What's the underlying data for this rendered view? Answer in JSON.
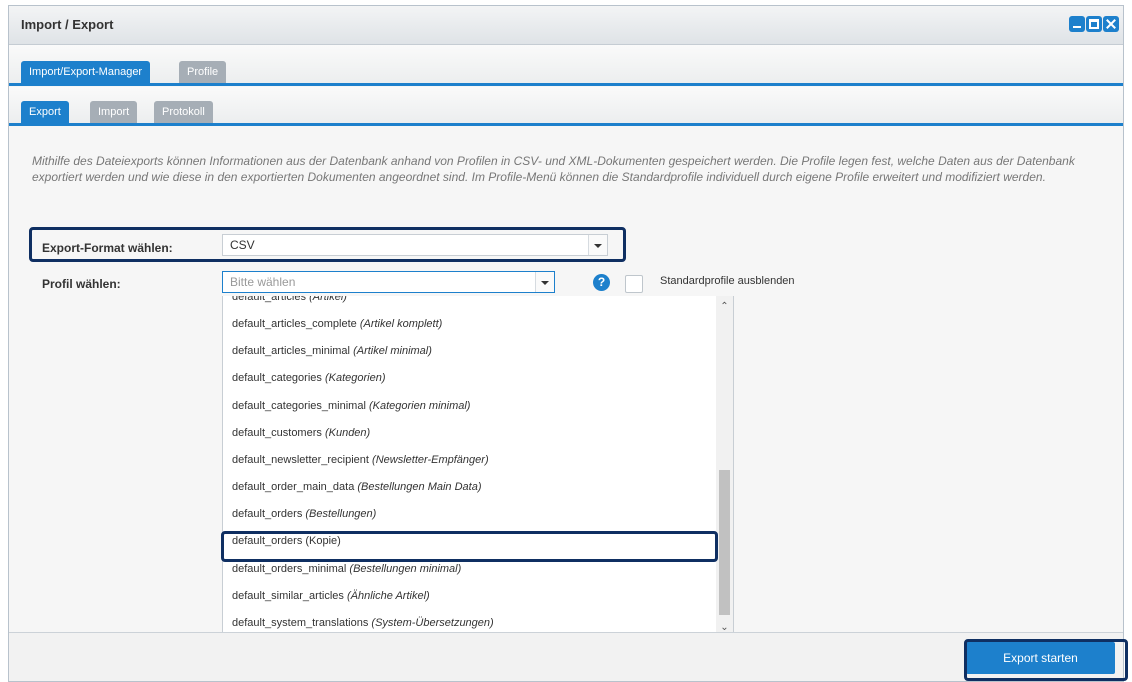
{
  "window": {
    "title": "Import / Export"
  },
  "main_tabs": [
    {
      "label": "Import/Export-Manager",
      "active": true
    },
    {
      "label": "Profile",
      "active": false
    }
  ],
  "sub_tabs": [
    {
      "label": "Export",
      "active": true
    },
    {
      "label": "Import",
      "active": false
    },
    {
      "label": "Protokoll",
      "active": false
    }
  ],
  "description": "Mithilfe des Dateiexports können Informationen aus der Datenbank anhand von Profilen in CSV- und XML-Dokumenten gespeichert werden. Die Profile legen fest, welche Daten aus der Datenbank exportiert werden und wie diese in den exportierten Dokumenten angeordnet sind. Im Profile-Menü können die Standardprofile individuell durch eigene Profile erweitert und modifiziert werden.",
  "format": {
    "label": "Export-Format wählen:",
    "value": "CSV"
  },
  "profile": {
    "label": "Profil wählen:",
    "placeholder": "Bitte wählen",
    "help": "?",
    "hide_default_label": "Standardprofile ausblenden",
    "hide_default_checked": false
  },
  "profile_options": [
    {
      "name": "default_articles",
      "desc": "(Artikel)"
    },
    {
      "name": "default_articles_complete",
      "desc": "(Artikel komplett)"
    },
    {
      "name": "default_articles_minimal",
      "desc": "(Artikel minimal)"
    },
    {
      "name": "default_categories",
      "desc": "(Kategorien)"
    },
    {
      "name": "default_categories_minimal",
      "desc": "(Kategorien minimal)"
    },
    {
      "name": "default_customers",
      "desc": "(Kunden)"
    },
    {
      "name": "default_newsletter_recipient",
      "desc": "(Newsletter-Empfänger)"
    },
    {
      "name": "default_order_main_data",
      "desc": "(Bestellungen Main Data)"
    },
    {
      "name": "default_orders",
      "desc": "(Bestellungen)"
    },
    {
      "name": "default_orders (Kopie)",
      "desc": ""
    },
    {
      "name": "default_orders_minimal",
      "desc": "(Bestellungen minimal)"
    },
    {
      "name": "default_similar_articles",
      "desc": "(Ähnliche Artikel)"
    },
    {
      "name": "default_system_translations",
      "desc": "(System-Übersetzungen)"
    }
  ],
  "footer": {
    "export_button": "Export starten"
  },
  "colors": {
    "accent": "#1d80cc",
    "highlight": "#0f2f62"
  }
}
